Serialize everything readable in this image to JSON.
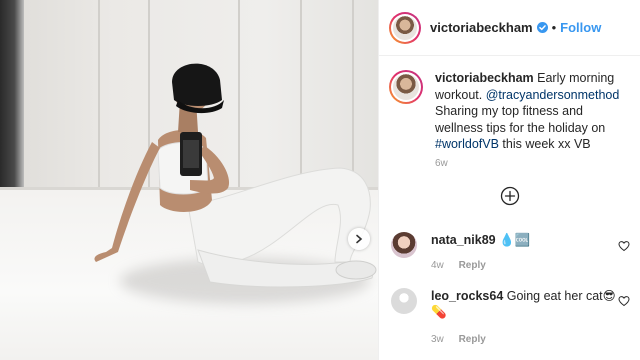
{
  "post": {
    "username": "victoriabeckham",
    "follow_label": "Follow",
    "dot": "•",
    "caption_username": "victoriabeckham",
    "caption_parts": {
      "intro": " Early morning workout. ",
      "mention": "@tracyandersonmethod",
      "middle": " Sharing my top fitness and wellness tips for the holiday on ",
      "hashtag": "#worldofVB",
      "end": " this week xx VB"
    },
    "time_ago": "6w"
  },
  "comments": [
    {
      "username": "nata_nik89",
      "text": "💧🆒",
      "time_ago": "4w",
      "reply_label": "Reply"
    },
    {
      "username": "leo_rocks64",
      "text": " Going eat her cat😎💊",
      "time_ago": "3w",
      "reply_label": "Reply"
    }
  ],
  "colors": {
    "accent": "#3897f0",
    "link": "#003569",
    "meta": "#999999"
  },
  "icons": [
    "verified-badge-icon",
    "plus-circle-icon",
    "chevron-right-icon",
    "heart-icon"
  ]
}
